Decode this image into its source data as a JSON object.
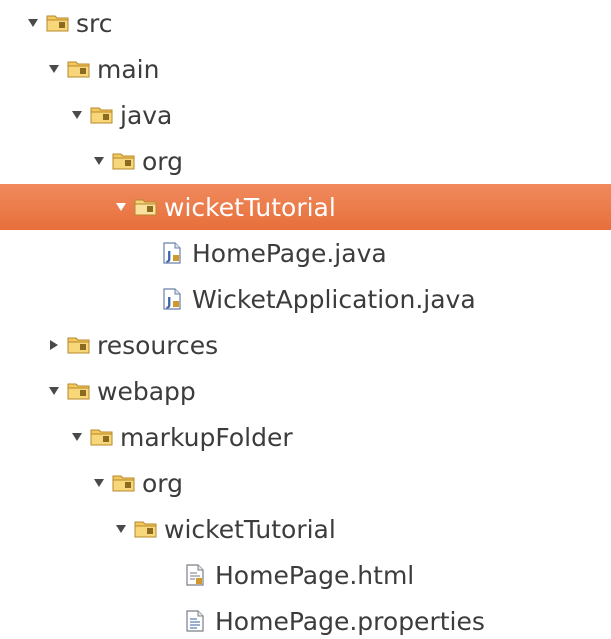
{
  "tree": {
    "nodes": [
      {
        "label": "src",
        "type": "package-folder",
        "expanded": true,
        "depth": 0
      },
      {
        "label": "main",
        "type": "package-folder",
        "expanded": true,
        "depth": 1
      },
      {
        "label": "java",
        "type": "package-folder",
        "expanded": true,
        "depth": 2
      },
      {
        "label": "org",
        "type": "package-folder",
        "expanded": true,
        "depth": 3
      },
      {
        "label": "wicketTutorial",
        "type": "package-folder",
        "expanded": true,
        "depth": 4,
        "selected": true
      },
      {
        "label": "HomePage.java",
        "type": "java-file",
        "depth": 5
      },
      {
        "label": "WicketApplication.java",
        "type": "java-file",
        "depth": 5
      },
      {
        "label": "resources",
        "type": "package-folder",
        "expanded": false,
        "depth": 1
      },
      {
        "label": "webapp",
        "type": "package-folder",
        "expanded": true,
        "depth": 1
      },
      {
        "label": "markupFolder",
        "type": "package-folder",
        "expanded": true,
        "depth": 2
      },
      {
        "label": "org",
        "type": "package-folder",
        "expanded": true,
        "depth": 3
      },
      {
        "label": "wicketTutorial",
        "type": "package-folder",
        "expanded": true,
        "depth": 4
      },
      {
        "label": "HomePage.html",
        "type": "text-file",
        "depth": 5
      },
      {
        "label": "HomePage.properties",
        "type": "properties-file",
        "depth": 5
      }
    ]
  },
  "colors": {
    "selection": "#e76f3b",
    "folder": "#e8b84a",
    "text": "#3c3c3c"
  }
}
